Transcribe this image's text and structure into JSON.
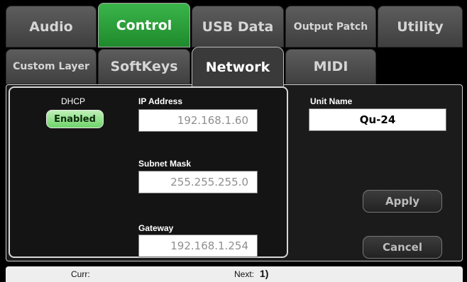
{
  "tabs_row1": [
    "Audio",
    "Control",
    "USB Data",
    "Output Patch",
    "Utility"
  ],
  "tabs_row2": [
    "Custom Layer",
    "SoftKeys",
    "Network",
    "MIDI"
  ],
  "network": {
    "dhcp_label": "DHCP",
    "dhcp_button": "Enabled",
    "ip_label": "IP Address",
    "ip_value": "192.168.1.60",
    "subnet_label": "Subnet Mask",
    "subnet_value": "255.255.255.0",
    "gateway_label": "Gateway",
    "gateway_value": "192.168.1.254",
    "unit_name_label": "Unit Name",
    "unit_name_value": "Qu-24",
    "apply_button": "Apply",
    "cancel_button": "Cancel"
  },
  "status": {
    "curr_label": "Curr:",
    "next_label": "Next:",
    "next_value": "1)"
  },
  "colors": {
    "active_green": "#2ea23c",
    "dhcp_green": "#8fe08a",
    "tab_grey": "#4d4d4d"
  }
}
